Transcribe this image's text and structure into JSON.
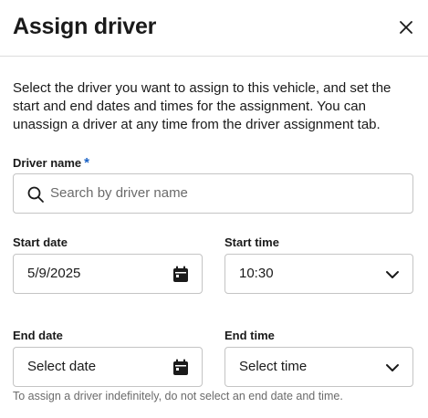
{
  "dialog": {
    "title": "Assign driver",
    "description": "Select the driver you want to assign to this vehicle, and set the start and end dates and times for the assignment. You can unassign a driver at any time from the driver assignment tab."
  },
  "driver_name": {
    "label": "Driver name",
    "required_marker": "*",
    "placeholder": "Search by driver name"
  },
  "start_date": {
    "label": "Start date",
    "value": "5/9/2025"
  },
  "start_time": {
    "label": "Start time",
    "value": "10:30"
  },
  "end_date": {
    "label": "End date",
    "placeholder": "Select date"
  },
  "end_time": {
    "label": "End time",
    "placeholder": "Select time"
  },
  "helper_text": "To assign a driver indefinitely, do not select an end date and time.",
  "icons": {
    "close": "close-icon",
    "search": "search-icon",
    "calendar": "calendar-icon",
    "chevron": "chevron-down-icon"
  },
  "colors": {
    "required_marker": "#1b63c6",
    "field_border": "#c4c4c4",
    "divider": "#dcdcdc"
  }
}
